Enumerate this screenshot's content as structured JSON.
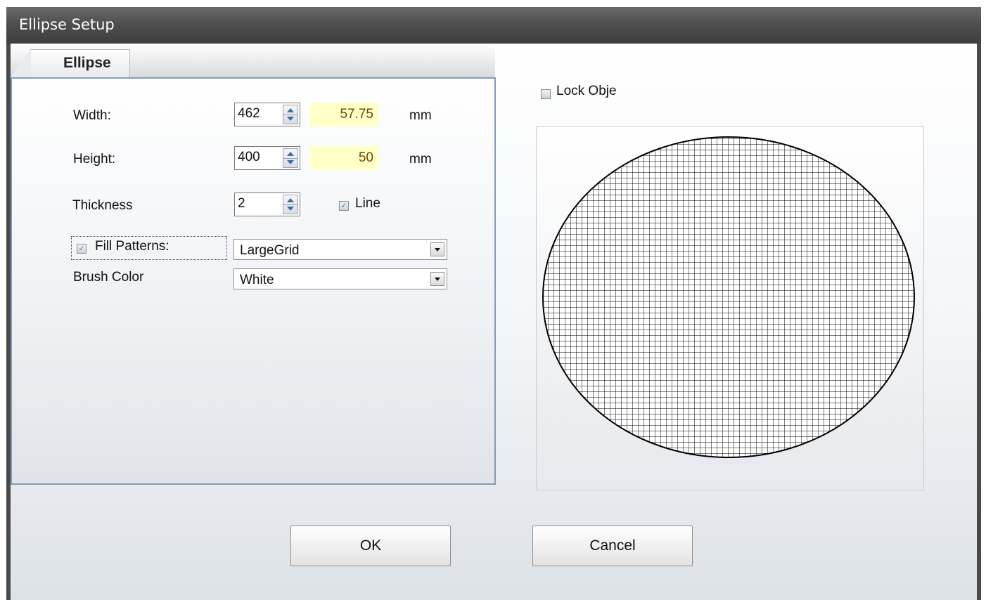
{
  "window": {
    "title": "Ellipse Setup"
  },
  "tabs": [
    {
      "label": "Ellipse"
    }
  ],
  "form": {
    "width": {
      "label": "Width:",
      "value": "462",
      "mm": "57.75",
      "unit": "mm"
    },
    "height": {
      "label": "Height:",
      "value": "400",
      "mm": "50",
      "unit": "mm"
    },
    "thickness": {
      "label": "Thickness",
      "value": "2"
    },
    "line": {
      "label": "Line",
      "checked": true
    },
    "fill_patterns": {
      "label": "Fill Patterns:",
      "checked": true,
      "selected": "LargeGrid"
    },
    "brush_color": {
      "label": "Brush Color",
      "selected": "White"
    }
  },
  "lock_object": {
    "label": "Lock Obje",
    "checked": false
  },
  "preview": {
    "shape": "ellipse",
    "fill_pattern": "LargeGrid",
    "stroke": "#000000"
  },
  "buttons": {
    "ok": "OK",
    "cancel": "Cancel"
  }
}
